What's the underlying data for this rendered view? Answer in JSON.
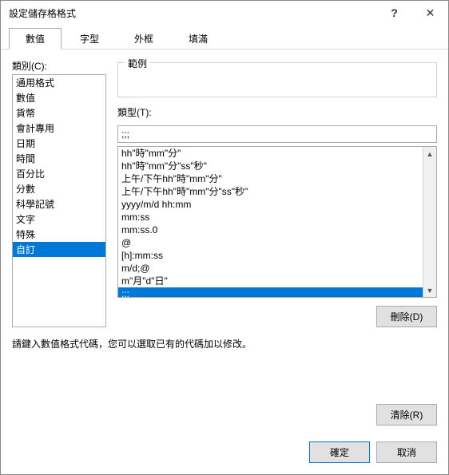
{
  "window": {
    "title": "設定儲存格格式",
    "help": "?",
    "close": "✕"
  },
  "tabs": {
    "items": [
      "數值",
      "字型",
      "外框",
      "填滿"
    ],
    "activeIndex": 0
  },
  "category": {
    "label": "類別(C):",
    "items": [
      "通用格式",
      "數值",
      "貨幣",
      "會計專用",
      "日期",
      "時間",
      "百分比",
      "分數",
      "科學記號",
      "文字",
      "特殊",
      "自訂"
    ],
    "selectedIndex": 11
  },
  "example": {
    "label": "範例",
    "value": ""
  },
  "type": {
    "label": "類型(T):",
    "input": ";;;",
    "items": [
      "hh\"時\"mm\"分\"",
      "hh\"時\"mm\"分\"ss\"秒\"",
      "上午/下午hh\"時\"mm\"分\"",
      "上午/下午hh\"時\"mm\"分\"ss\"秒\"",
      "yyyy/m/d hh:mm",
      "mm:ss",
      "mm:ss.0",
      "@",
      "[h]:mm:ss",
      "m/d;@",
      "m\"月\"d\"日\"",
      ";;;"
    ],
    "selectedIndex": 11
  },
  "buttons": {
    "delete": "刪除(D)",
    "clear": "清除(R)",
    "ok": "確定",
    "cancel": "取消"
  },
  "hint": "請鍵入數值格式代碼，您可以選取已有的代碼加以修改。"
}
